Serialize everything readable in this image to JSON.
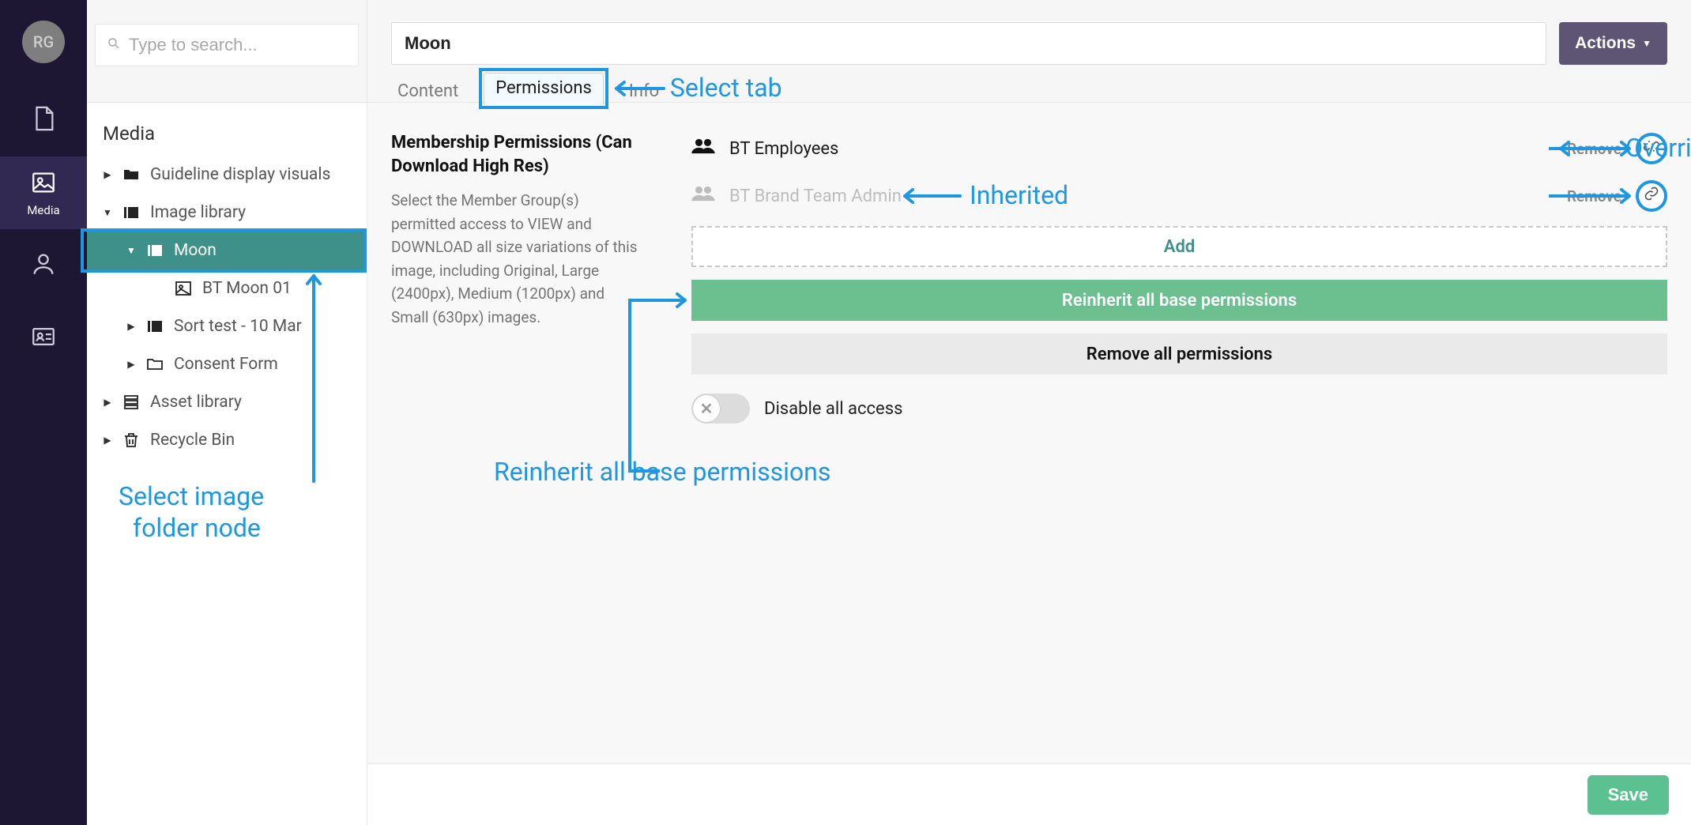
{
  "avatar_initials": "RG",
  "search": {
    "placeholder": "Type to search..."
  },
  "rail": {
    "media_label": "Media"
  },
  "tree": {
    "heading": "Media",
    "items": [
      {
        "label": "Guideline display visuals"
      },
      {
        "label": "Image library"
      },
      {
        "label": "Moon"
      },
      {
        "label": "BT Moon 01"
      },
      {
        "label": "Sort test - 10 Mar"
      },
      {
        "label": "Consent Form"
      },
      {
        "label": "Asset library"
      },
      {
        "label": "Recycle Bin"
      }
    ]
  },
  "header": {
    "title": "Moon",
    "actions_label": "Actions",
    "tabs": {
      "content": "Content",
      "permissions": "Permissions",
      "info": "Info"
    }
  },
  "perm": {
    "heading": "Membership Permissions (Can Download High Res)",
    "desc": "Select the Member Group(s) permitted access to VIEW and DOWNLOAD all size variations of this image, including Original, Large (2400px), Medium (1200px) and Small (630px) images.",
    "groups": [
      {
        "name": "BT Employees",
        "remove": "Remove"
      },
      {
        "name": "BT Brand Team Admin",
        "remove": "Remove"
      }
    ],
    "add_label": "Add",
    "reinherit_label": "Reinherit all base permissions",
    "removeall_label": "Remove all permissions",
    "disable_label": "Disable all access"
  },
  "footer": {
    "save_label": "Save"
  },
  "annotations": {
    "select_tab": "Select tab",
    "override": "Override",
    "inherited": "Inherited",
    "reinherit": "Reinherit all base permissions",
    "select_folder_l1": "Select image",
    "select_folder_l2": "folder node"
  }
}
